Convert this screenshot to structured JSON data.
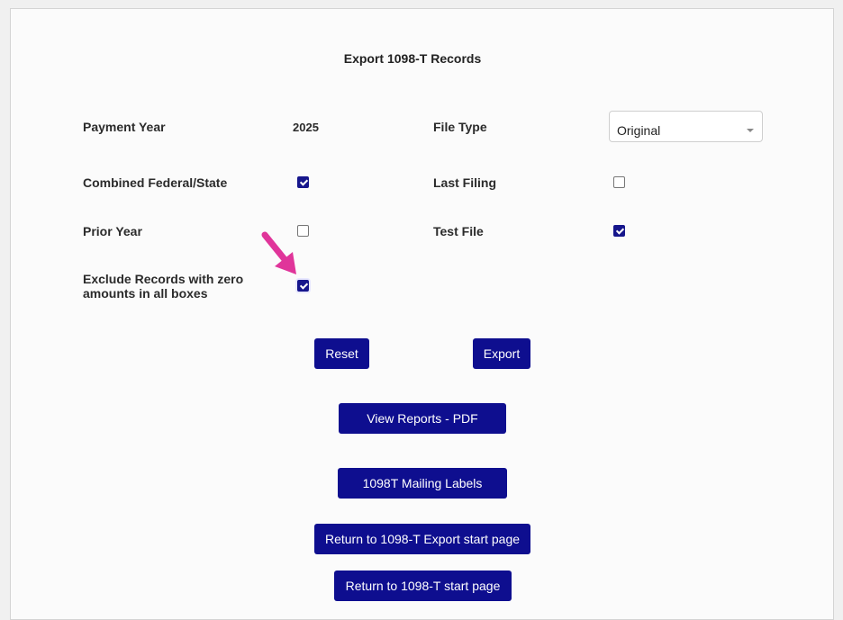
{
  "title": "Export 1098-T Records",
  "fields": {
    "payment_year_label": "Payment Year",
    "payment_year_value": "2025",
    "file_type_label": "File Type",
    "file_type_value": "Original",
    "combined_label": "Combined Federal/State",
    "combined_checked": true,
    "last_filing_label": "Last Filing",
    "last_filing_checked": false,
    "prior_year_label": "Prior Year",
    "prior_year_checked": false,
    "test_file_label": "Test File",
    "test_file_checked": true,
    "exclude_label_line1": "Exclude Records with zero",
    "exclude_label_line2": "amounts in all boxes",
    "exclude_checked": true
  },
  "buttons": {
    "reset": "Reset",
    "export": "Export",
    "view_reports": "View Reports - PDF",
    "mailing_labels": "1098T Mailing Labels",
    "return_export": "Return to 1098-T Export start page",
    "return_start": "Return to 1098-T start page"
  },
  "annotation": {
    "arrow_color": "#e0359a",
    "icon": "pointer-arrow-icon"
  },
  "colors": {
    "button_bg": "#0e0e8f",
    "checkbox_checked": "#16168c"
  }
}
